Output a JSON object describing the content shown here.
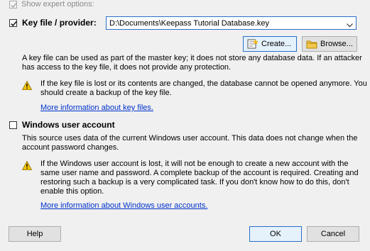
{
  "expert": {
    "label": "Show expert options:"
  },
  "keyfile": {
    "label": "Key file / provider:",
    "path": "D:\\Documents\\Keepass Tutorial Database.key",
    "create_label": "Create...",
    "browse_label": "Browse...",
    "desc_line1": "A key file can be used as part of the master key; it does not store any database data. If an attacker",
    "desc_line2": "has access to the key file, it does not provide any protection.",
    "warn_line1": "If the key file is lost or its contents are changed, the database cannot be opened anymore. You",
    "warn_line2": "should create a backup of the key file.",
    "more_link": "More information about key files."
  },
  "windows": {
    "label": "Windows user account",
    "desc_line1": "This source uses data of the current Windows user account. This data does not change when the",
    "desc_line2": "account password changes.",
    "warn_line1": "If the Windows user account is lost, it will not be enough to create a new account with the",
    "warn_line2": "same user name and password. A complete backup of the account is required. Creating and",
    "warn_line3": "restoring such a backup is a very complicated task. If you don't know how to do this, don't",
    "warn_line4": "enable this option.",
    "more_link": "More information about Windows user accounts."
  },
  "footer": {
    "help_label": "Help",
    "ok_label": "OK",
    "cancel_label": "Cancel"
  },
  "colors": {
    "accent": "#2a6fc9",
    "link": "#0033cc",
    "warning": "#f5c400"
  }
}
